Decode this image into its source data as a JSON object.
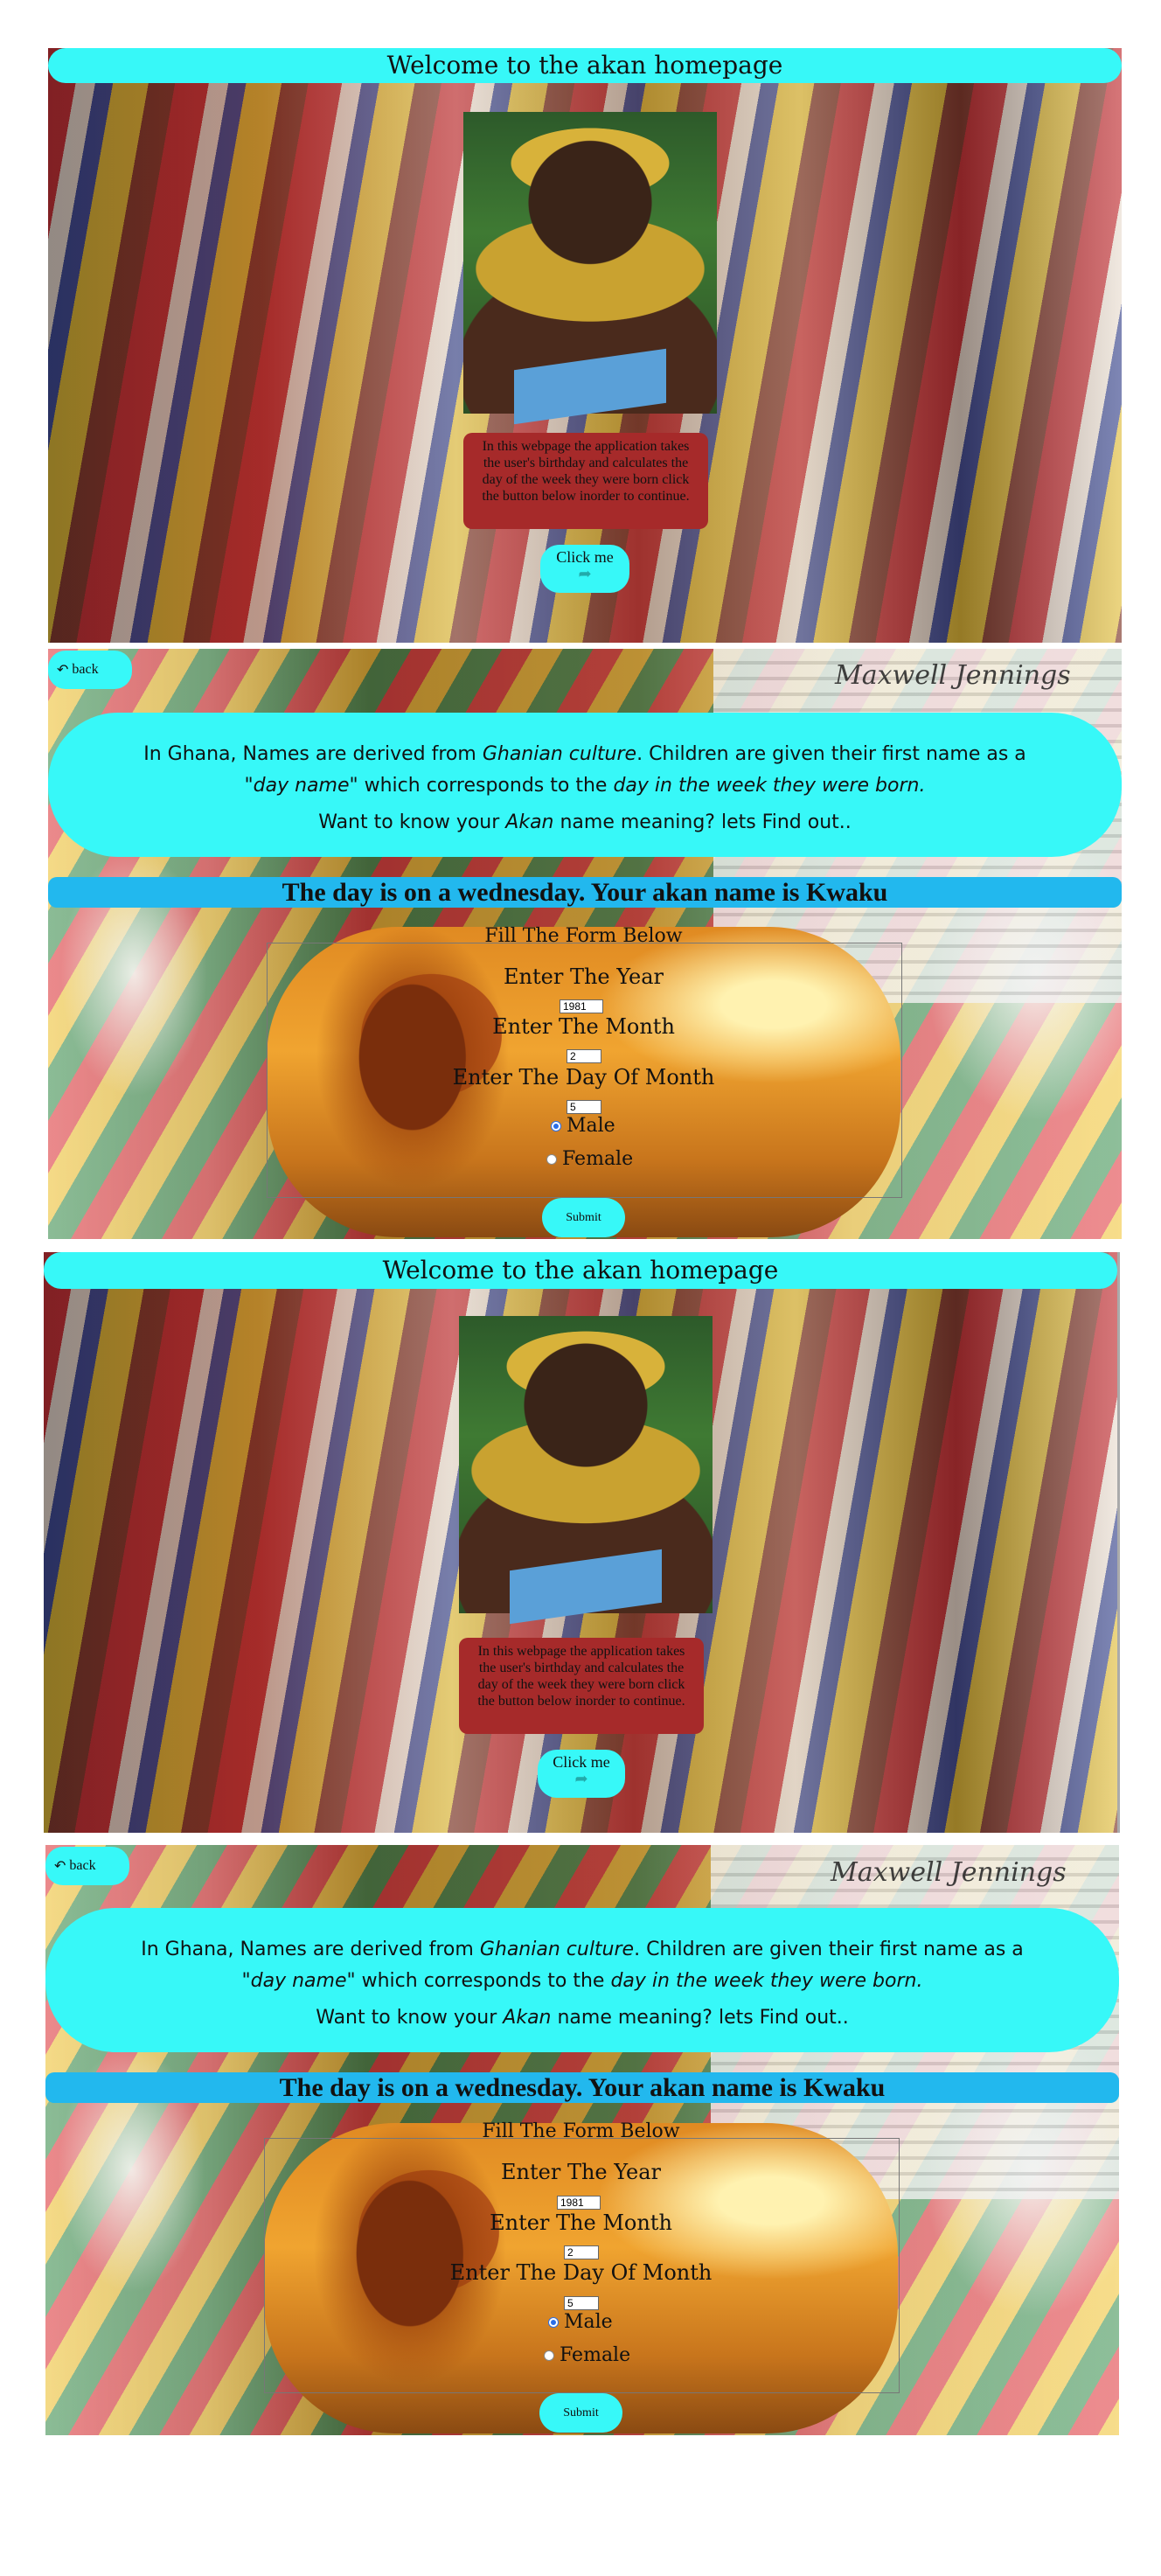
{
  "hero": {
    "title": "Welcome to the akan homepage",
    "intro": "In this webpage the application takes the user's birthday and calculates the day of the week they were born click the button below inorder to continue.",
    "click_label": "Click me",
    "arrow_icon": "curved-arrow-icon"
  },
  "info": {
    "back_label": "back",
    "back_icon": "back-arrow-icon",
    "signature": "Maxwell Jennings",
    "line1_a": "In Ghana, Names are derived from ",
    "line1_em": "Ghanian culture",
    "line1_b": ". Children are given their first name as a",
    "line2_em1": "\"day name\"",
    "line2_a": " which corresponds to the ",
    "line2_em2": "day in the week they were born.",
    "line3_a": "Want to know your ",
    "line3_em": "Akan",
    "line3_b": " name meaning? lets Find out.."
  },
  "result": {
    "text": "The day is on a wednesday. Your akan name is Kwaku"
  },
  "form": {
    "title": "Fill The Form Below",
    "year_label": "Enter The Year",
    "year_value": "1981",
    "month_label": "Enter The Month",
    "month_value": "2",
    "day_label": "Enter The Day Of Month",
    "day_value": "5",
    "male_label": "Male",
    "female_label": "Female",
    "gender_selected": "Male",
    "submit_label": "Submit"
  },
  "colors": {
    "cyan": "#37f8f8",
    "result_blue": "#22b8ee",
    "intro_red": "#a62a2a"
  }
}
